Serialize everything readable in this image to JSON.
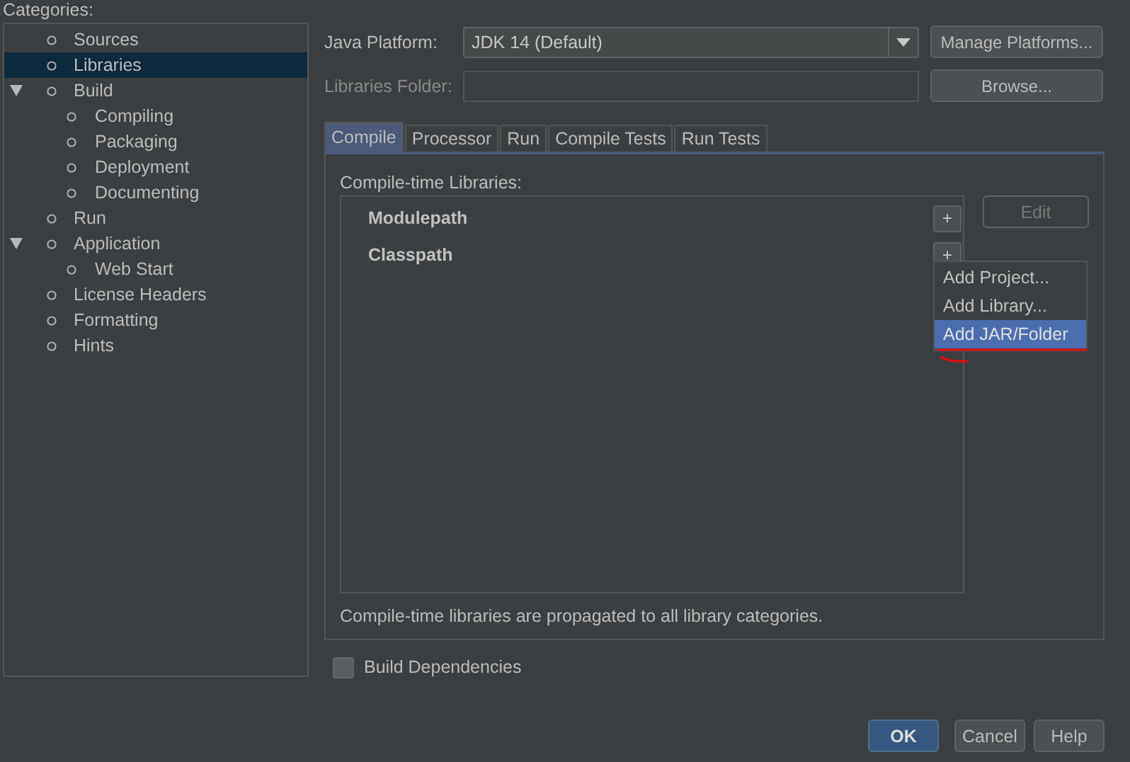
{
  "categories": {
    "label": "Categories:",
    "items": [
      {
        "label": "Sources",
        "selected": false
      },
      {
        "label": "Libraries",
        "selected": true
      },
      {
        "label": "Build",
        "selected": false,
        "expanded": true,
        "children": [
          {
            "label": "Compiling",
            "selected": false
          },
          {
            "label": "Packaging",
            "selected": false
          },
          {
            "label": "Deployment",
            "selected": false
          },
          {
            "label": "Documenting",
            "selected": false
          }
        ]
      },
      {
        "label": "Run",
        "selected": false
      },
      {
        "label": "Application",
        "selected": false,
        "expanded": true,
        "children": [
          {
            "label": "Web Start",
            "selected": false
          }
        ]
      },
      {
        "label": "License Headers",
        "selected": false
      },
      {
        "label": "Formatting",
        "selected": false
      },
      {
        "label": "Hints",
        "selected": false
      }
    ]
  },
  "java_platform": {
    "label": "Java Platform:",
    "value": "JDK 14 (Default)",
    "button": "Manage Platforms..."
  },
  "libraries_folder": {
    "label": "Libraries Folder:",
    "disabled": true,
    "button": "Browse..."
  },
  "tabs": [
    {
      "label": "Compile",
      "selected": true
    },
    {
      "label": "Processor",
      "selected": false
    },
    {
      "label": "Run",
      "selected": false
    },
    {
      "label": "Compile Tests",
      "selected": false
    },
    {
      "label": "Run Tests",
      "selected": false
    }
  ],
  "libraries": {
    "label": "Compile-time Libraries:",
    "groups": [
      {
        "label": "Modulepath",
        "add": "+"
      },
      {
        "label": "Classpath",
        "add": "+"
      }
    ],
    "side_buttons": [
      {
        "label": "Edit",
        "disabled": true
      }
    ],
    "menu": [
      {
        "label": "Add Project...",
        "selected": false
      },
      {
        "label": "Add Library...",
        "selected": false
      },
      {
        "label": "Add JAR/Folder",
        "selected": true
      }
    ],
    "note": "Compile-time libraries are propagated to all library categories."
  },
  "build_dependencies": {
    "label": "Build Dependencies",
    "checked": false
  },
  "buttons": [
    {
      "label": "OK",
      "kind": "primary"
    },
    {
      "label": "Cancel",
      "kind": "normal"
    },
    {
      "label": "Help",
      "kind": "normal"
    }
  ]
}
